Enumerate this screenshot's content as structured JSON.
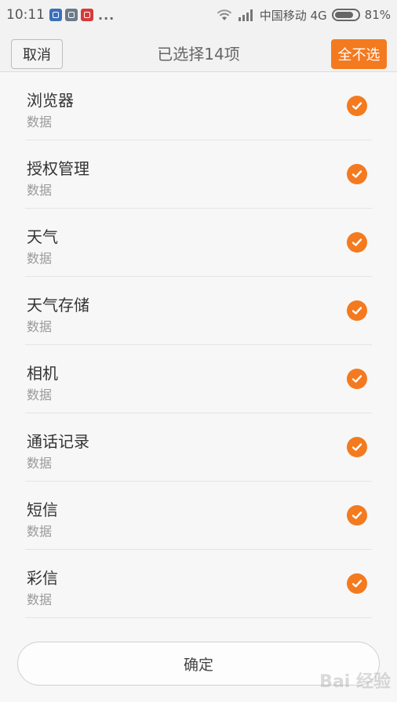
{
  "status_bar": {
    "time": "10:11",
    "more": "...",
    "carrier": "中国移动 4G",
    "battery_pct": "81%",
    "battery_level": 0.81
  },
  "header": {
    "cancel_label": "取消",
    "title": "已选择14项",
    "deselect_all_label": "全不选"
  },
  "items": [
    {
      "title": "浏览器",
      "subtitle": "数据",
      "checked": true
    },
    {
      "title": "授权管理",
      "subtitle": "数据",
      "checked": true
    },
    {
      "title": "天气",
      "subtitle": "数据",
      "checked": true
    },
    {
      "title": "天气存储",
      "subtitle": "数据",
      "checked": true
    },
    {
      "title": "相机",
      "subtitle": "数据",
      "checked": true
    },
    {
      "title": "通话记录",
      "subtitle": "数据",
      "checked": true
    },
    {
      "title": "短信",
      "subtitle": "数据",
      "checked": true
    },
    {
      "title": "彩信",
      "subtitle": "数据",
      "checked": true
    }
  ],
  "confirm_label": "确定",
  "watermark": "Bai 经验",
  "colors": {
    "accent": "#f47a1f",
    "background": "#f7f7f7"
  }
}
